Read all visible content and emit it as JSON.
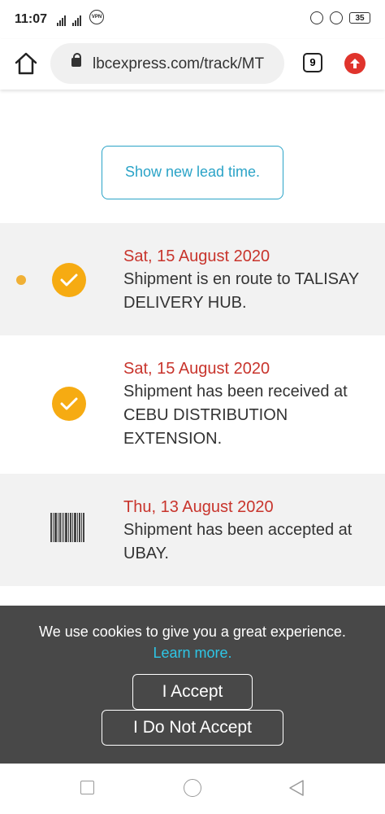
{
  "status_bar": {
    "time": "11:07",
    "network": "4G",
    "vpn": "VPN",
    "battery": "35"
  },
  "browser": {
    "url": "lbcexpress.com/track/MT",
    "tab_count": "9"
  },
  "lead_time_button": "Show new lead time.",
  "timeline": [
    {
      "date": "Sat, 15 August 2020",
      "description": "Shipment is en route to TALISAY DELIVERY HUB.",
      "icon": "check-icon",
      "current": true
    },
    {
      "date": "Sat, 15 August 2020",
      "description": "Shipment has been received at CEBU DISTRIBUTION EXTENSION.",
      "icon": "check-icon",
      "current": false
    },
    {
      "date": "Thu, 13 August 2020",
      "description": "Shipment has been accepted at UBAY.",
      "icon": "barcode-icon",
      "current": false
    }
  ],
  "cookie_banner": {
    "message": "We use cookies to give you a great experience.",
    "link": "Learn more.",
    "accept": "I Accept",
    "decline": "I Do Not Accept"
  },
  "colors": {
    "accent": "#2aa3c7",
    "date": "#c8342c",
    "check": "#f6ab12",
    "banner": "#484848"
  }
}
